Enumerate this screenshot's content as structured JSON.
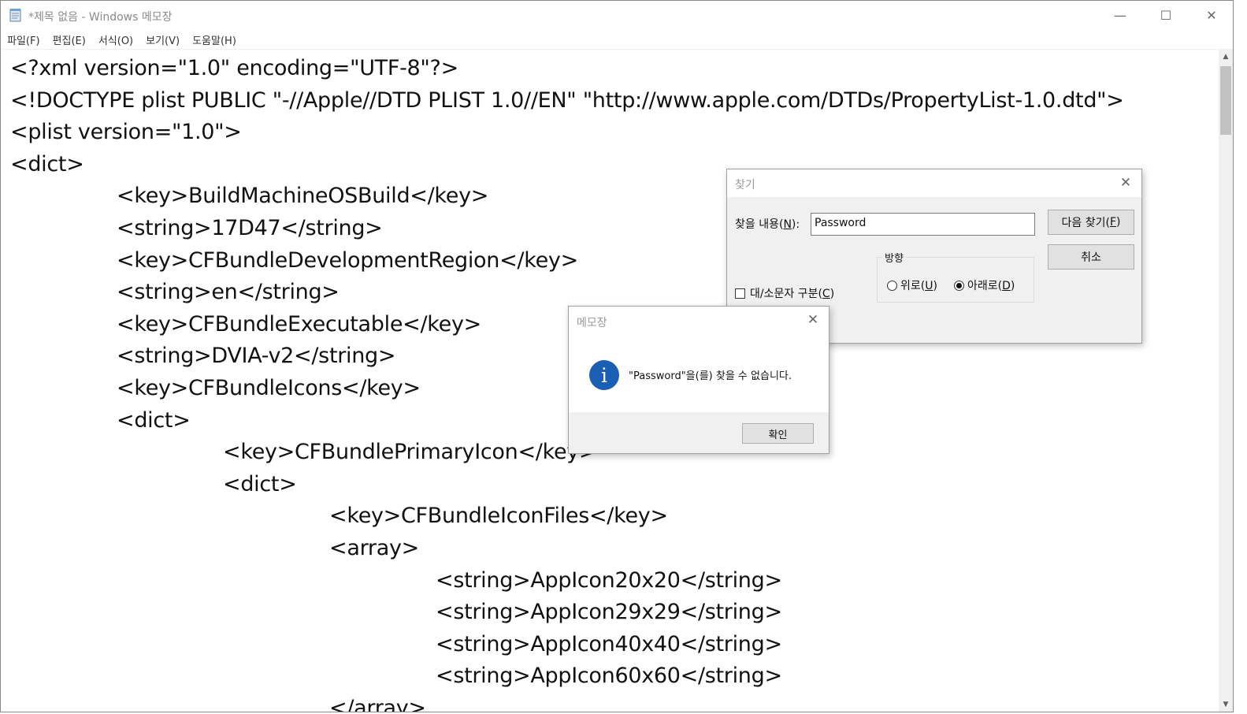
{
  "window": {
    "title": "*제목 없음 - Windows 메모장",
    "controls": {
      "minimize": "—",
      "maximize": "☐",
      "close": "✕"
    }
  },
  "menu": [
    {
      "label": "파일(F)"
    },
    {
      "label": "편집(E)"
    },
    {
      "label": "서식(O)"
    },
    {
      "label": "보기(V)"
    },
    {
      "label": "도움말(H)"
    }
  ],
  "editor": {
    "lines": [
      "<?xml version=\"1.0\" encoding=\"UTF-8\"?>",
      "<!DOCTYPE plist PUBLIC \"-//Apple//DTD PLIST 1.0//EN\" \"http://www.apple.com/DTDs/PropertyList-1.0.dtd\">",
      "<plist version=\"1.0\">",
      "<dict>",
      "\t<key>BuildMachineOSBuild</key>",
      "\t<string>17D47</string>",
      "\t<key>CFBundleDevelopmentRegion</key>",
      "\t<string>en</string>",
      "\t<key>CFBundleExecutable</key>",
      "\t<string>DVIA-v2</string>",
      "\t<key>CFBundleIcons</key>",
      "\t<dict>",
      "\t\t<key>CFBundlePrimaryIcon</key>",
      "\t\t<dict>",
      "\t\t\t<key>CFBundleIconFiles</key>",
      "\t\t\t<array>",
      "\t\t\t\t<string>AppIcon20x20</string>",
      "\t\t\t\t<string>AppIcon29x29</string>",
      "\t\t\t\t<string>AppIcon40x40</string>",
      "\t\t\t\t<string>AppIcon60x60</string>",
      "\t\t\t</array>"
    ]
  },
  "find_dialog": {
    "title": "찾기",
    "find_label": "찾을 내용(N):",
    "find_value": "Password",
    "find_next_button": "다음 찾기(F)",
    "cancel_button": "취소",
    "direction_label": "방향",
    "direction_up": "위로(U)",
    "direction_down": "아래로(D)",
    "direction_selected": "down",
    "match_case_label": "대/소문자 구분(C)",
    "match_case_checked": false
  },
  "message_box": {
    "title": "메모장",
    "icon": "info-icon",
    "message": "\"Password\"을(를) 찾을 수 없습니다.",
    "ok_button": "확인"
  }
}
